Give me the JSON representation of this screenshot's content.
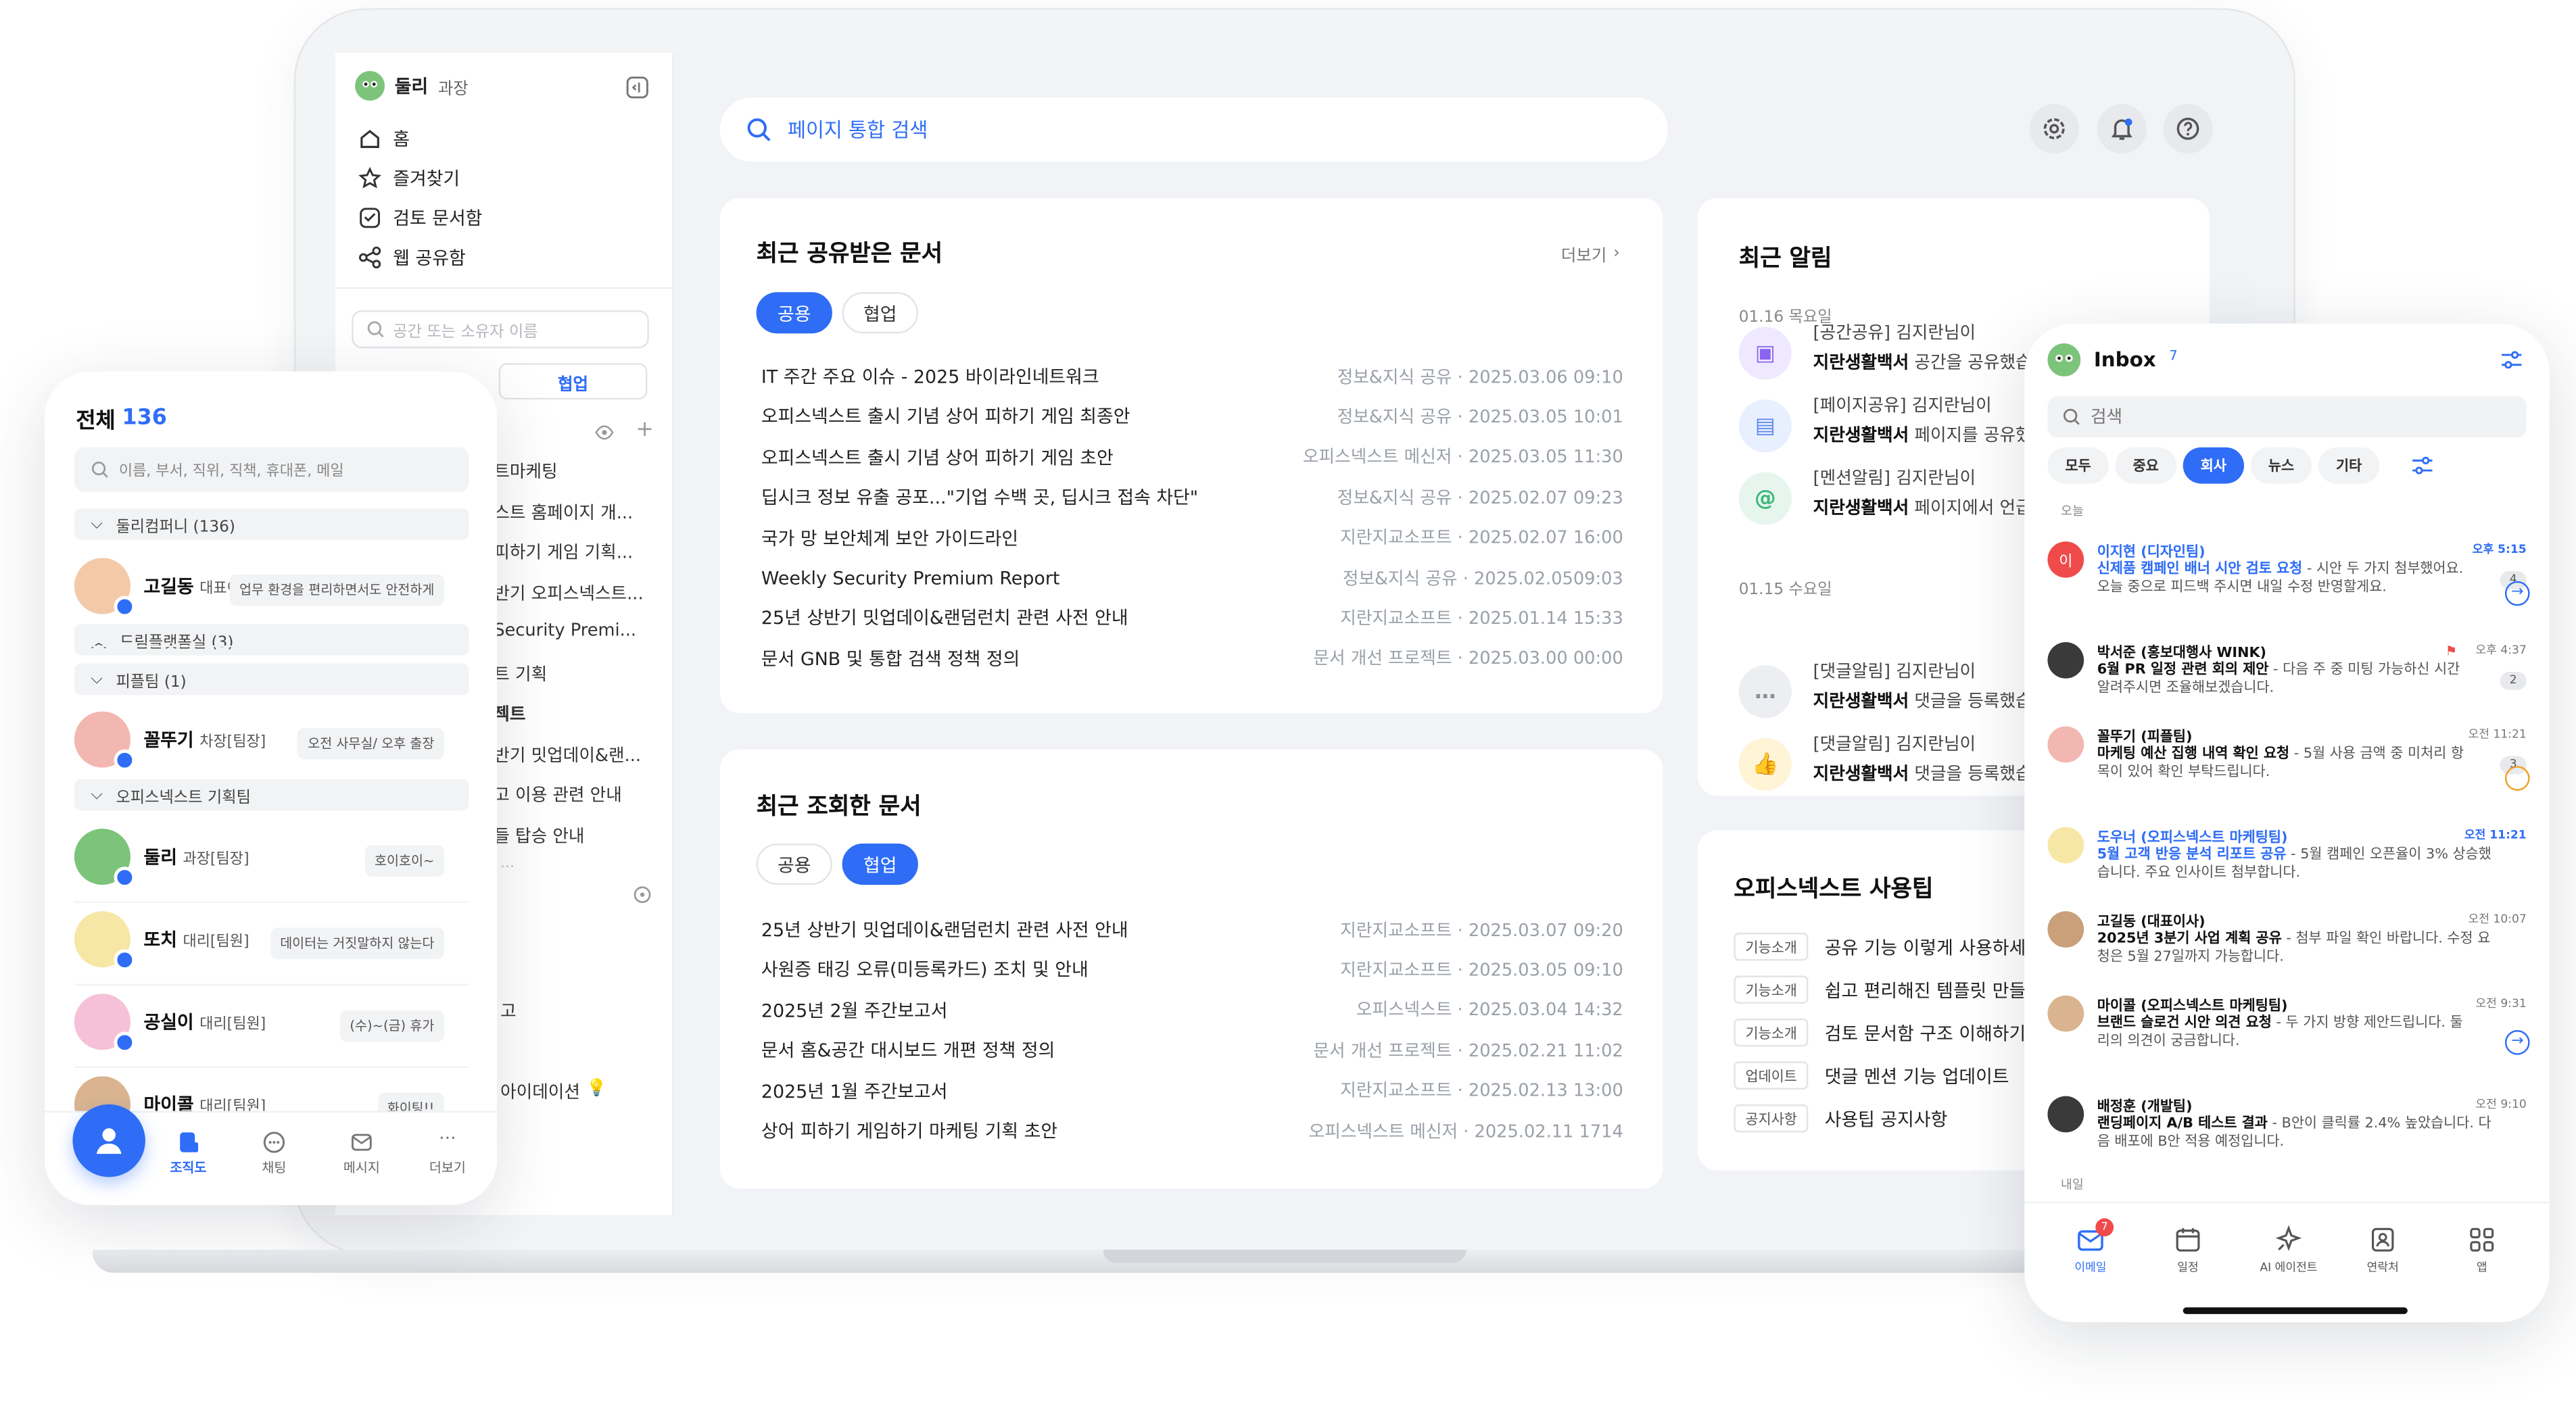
{
  "laptop": {
    "sidebar": {
      "user_name": "둘리",
      "user_title": "과장",
      "nav": [
        "홈",
        "즐겨찾기",
        "검토 문서함",
        "웹 공유함"
      ],
      "search_placeholder": "공간 또는 소유자 이름",
      "tab_active": "협업",
      "partial_items": [
        "트마케팅",
        "스트 홈페이지 개...",
        "피하기 게임 기획...",
        "반기 오피스넥스트...",
        "Security Premi...",
        "트 기획",
        "젝트",
        "반기 밋업데이&랜...",
        "고 이용 관련 안내",
        "들 탑승 안내"
      ],
      "partial_bottom": [
        "고",
        "아이데이션"
      ]
    },
    "search_placeholder": "페이지 통합 검색",
    "shared": {
      "title": "최근 공유받은 문서",
      "more": "더보기",
      "tabs": [
        "공용",
        "협업"
      ],
      "rows": [
        {
          "t": "IT 주간 주요 이슈 - 2025 바이라인네트워크",
          "m": "정보&지식 공유 · 2025.03.06 09:10"
        },
        {
          "t": "오피스넥스트 출시 기념 상어 피하기 게임 최종안",
          "m": "정보&지식 공유 · 2025.03.05 10:01"
        },
        {
          "t": "오피스넥스트 출시 기념 상어 피하기 게임 초안",
          "m": "오피스넥스트 메신저 · 2025.03.05 11:30"
        },
        {
          "t": "딥시크 정보 유출 공포...\"기업 수백 곳, 딥시크 접속 차단\"",
          "m": "정보&지식 공유 · 2025.02.07 09:23"
        },
        {
          "t": "국가 망 보안체계 보안 가이드라인",
          "m": "지란지교소프트 · 2025.02.07 16:00"
        },
        {
          "t": "Weekly Security Premium Report",
          "m": "정보&지식 공유 · 2025.02.0509:03"
        },
        {
          "t": "25년 상반기 밋업데이&랜덤런치 관련 사전 안내",
          "m": "지란지교소프트 · 2025.01.14 15:33"
        },
        {
          "t": "문서 GNB 및 통합 검색 정책 정의",
          "m": "문서 개선 프로젝트 · 2025.03.00 00:00"
        }
      ]
    },
    "viewed": {
      "title": "최근 조회한 문서",
      "tabs": [
        "공용",
        "협업"
      ],
      "rows": [
        {
          "t": "25년 상반기 밋업데이&랜덤런치 관련 사전 안내",
          "m": "지란지교소프트 · 2025.03.07 09:20"
        },
        {
          "t": "사원증 태깅 오류(미등록카드) 조치 및 안내",
          "m": "지란지교소프트 · 2025.03.05 09:10"
        },
        {
          "t": "2025년 2월 주간보고서",
          "m": "오피스넥스트 · 2025.03.04 14:32"
        },
        {
          "t": "문서 홈&공간 대시보드 개편 정책 정의",
          "m": "문서 개선 프로젝트 · 2025.02.21 11:02"
        },
        {
          "t": "2025년 1월 주간보고서",
          "m": "지란지교소프트 · 2025.02.13 13:00"
        },
        {
          "t": "상어 피하기 게임하기 마케팅 기획 초안",
          "m": "오피스넥스트 메신저 · 2025.02.11 1714"
        }
      ]
    },
    "alerts": {
      "title": "최근 알림",
      "date1": "01.16 목요일",
      "date2": "01.15 수요일",
      "items": [
        {
          "h": "[공간공유] 김지란님이",
          "b1": "지란생활백서",
          "b2": " 공간을 공유했습니다"
        },
        {
          "h": "[페이지공유] 김지란님이",
          "b1": "지란생활백서",
          "b2": " 페이지를 공유했습니다"
        },
        {
          "h": "[멘션알림] 김지란님이",
          "b1": "지란생활백서",
          "b2": " 페이지에서 언급했습니다"
        },
        {
          "h": "[댓글알림] 김지란님이",
          "b1": "지란생활백서",
          "b2": " 댓글을 등록했습니다"
        },
        {
          "h": "[댓글알림] 김지란님이",
          "b1": "지란생활백서",
          "b2": " 댓글을 등록했습니다"
        }
      ]
    },
    "tips": {
      "title": "오피스넥스트 사용팁",
      "rows": [
        {
          "tag": "기능소개",
          "t": "공유 기능 이렇게 사용하세요"
        },
        {
          "tag": "기능소개",
          "t": "쉽고 편리해진 템플릿 만들기"
        },
        {
          "tag": "기능소개",
          "t": "검토 문서함 구조 이해하기"
        },
        {
          "tag": "업데이트",
          "t": "댓글 멘션 기능 업데이트"
        },
        {
          "tag": "공지사항",
          "t": "사용팁 공지사항"
        }
      ]
    }
  },
  "org": {
    "title": "전체",
    "count": "136",
    "search_placeholder": "이름, 부서, 직위, 직책, 휴대폰, 메일",
    "groups": [
      "둘리컴퍼니 (136)",
      "드림플랫폼실 (3)",
      "피플팀 (1)",
      "오피스넥스트 기획팀"
    ],
    "people": [
      {
        "name": "고길동",
        "title": "대표이사",
        "status": "업무 환경을 편리하면서도 안전하게"
      },
      {
        "name": "꼴뚜기",
        "title": "차장[팀장]",
        "status": "오전 사무실/ 오후 출장"
      },
      {
        "name": "둘리",
        "title": "과장[팀장]",
        "status": "호이호이~"
      },
      {
        "name": "또치",
        "title": "대리[팀원]",
        "status": "데이터는 거짓말하지 않는다"
      },
      {
        "name": "공실이",
        "title": "대리[팀원]",
        "status": "(수)~(금) 휴가"
      },
      {
        "name": "마이콜",
        "title": "대리[팀원]",
        "status": "화이팅!!"
      }
    ],
    "tabs": [
      "조직도",
      "채팅",
      "메시지",
      "더보기"
    ]
  },
  "inbox": {
    "title": "Inbox",
    "count": "7",
    "search_placeholder": "검색",
    "filters": [
      "모두",
      "중요",
      "회사",
      "뉴스",
      "기타"
    ],
    "today": "오늘",
    "tomorrow": "내일",
    "mails": [
      {
        "from": "이지현 (디자인팀)",
        "time": "오후 5:15",
        "subject": "신제품 캠페인 배너 시안 검토 요청",
        "preview": " - 시안 두 가지 첨부했어요.",
        "line2": "오늘 중으로 피드백 주시면 내일 수정 반영할게요.",
        "count": "4"
      },
      {
        "from": "박서준 (홍보대행사 WINK)",
        "time": "오후 4:37",
        "subject": "6월 PR 일정 관련 회의 제안",
        "preview": " - 다음 주 중 미팅 가능하신 시간",
        "line2": "알려주시면 조율해보겠습니다.",
        "count": "2"
      },
      {
        "from": "꼴뚜기 (피플팀)",
        "time": "오전 11:21",
        "subject": "마케팅 예산 집행 내역 확인 요청",
        "preview": " - 5월 사용 금액 중 미처리 항",
        "line2": "목이 있어 확인 부탁드립니다.",
        "count": "3"
      },
      {
        "from": "도우너 (오피스넥스트 마케팅팀)",
        "time": "오전 11:21",
        "subject": "5월 고객 반응 분석 리포트 공유",
        "preview": " - 5월 캠페인 오픈율이 3% 상승했",
        "line2": "습니다. 주요 인사이트 첨부합니다.",
        "count": ""
      },
      {
        "from": "고길동 (대표이사)",
        "time": "오전 10:07",
        "subject": "2025년 3분기 사업 계획 공유",
        "preview": " - 첨부 파일 확인 바랍니다. 수정 요",
        "line2": "청은 5월 27일까지 가능합니다.",
        "count": ""
      },
      {
        "from": "마이콜 (오피스넥스트 마케팅팀)",
        "time": "오전 9:31",
        "subject": "브랜드 슬로건 시안 의견 요청",
        "preview": " - 두 가지 방향 제안드립니다. 둘",
        "line2": "리의 의견이 궁금합니다.",
        "count": ""
      },
      {
        "from": "배정훈 (개발팀)",
        "time": "오전 9:10",
        "subject": "랜딩페이지 A/B 테스트 결과",
        "preview": " - B안이 클릭률 2.4% 높았습니다. 다",
        "line2": "음 배포에 B안 적용 예정입니다.",
        "count": ""
      }
    ],
    "avatar_letter": "이",
    "tabs": [
      "이메일",
      "일정",
      "AI 에이전트",
      "연락처",
      "앱"
    ],
    "mail_badge": "7"
  }
}
